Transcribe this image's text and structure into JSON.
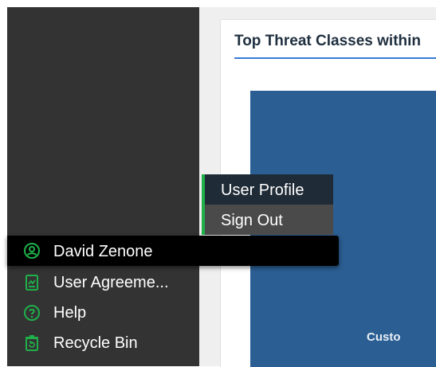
{
  "card": {
    "title": "Top Threat Classes within",
    "chart_label": "Custo"
  },
  "popup_menu": {
    "items": [
      {
        "label": "User Profile"
      },
      {
        "label": "Sign Out"
      }
    ]
  },
  "sidebar": {
    "user": {
      "label": "David Zenone",
      "icon": "user-circle-icon"
    },
    "items": [
      {
        "label": "User Agreeme...",
        "icon": "document-icon"
      },
      {
        "label": "Help",
        "icon": "help-circle-icon"
      },
      {
        "label": "Recycle Bin",
        "icon": "recycle-bin-icon"
      }
    ]
  },
  "colors": {
    "sidebar_bg": "#333333",
    "accent_green": "#1fb04a",
    "chart_blue": "#2b5e93",
    "title_underline": "#3a7bd5"
  }
}
